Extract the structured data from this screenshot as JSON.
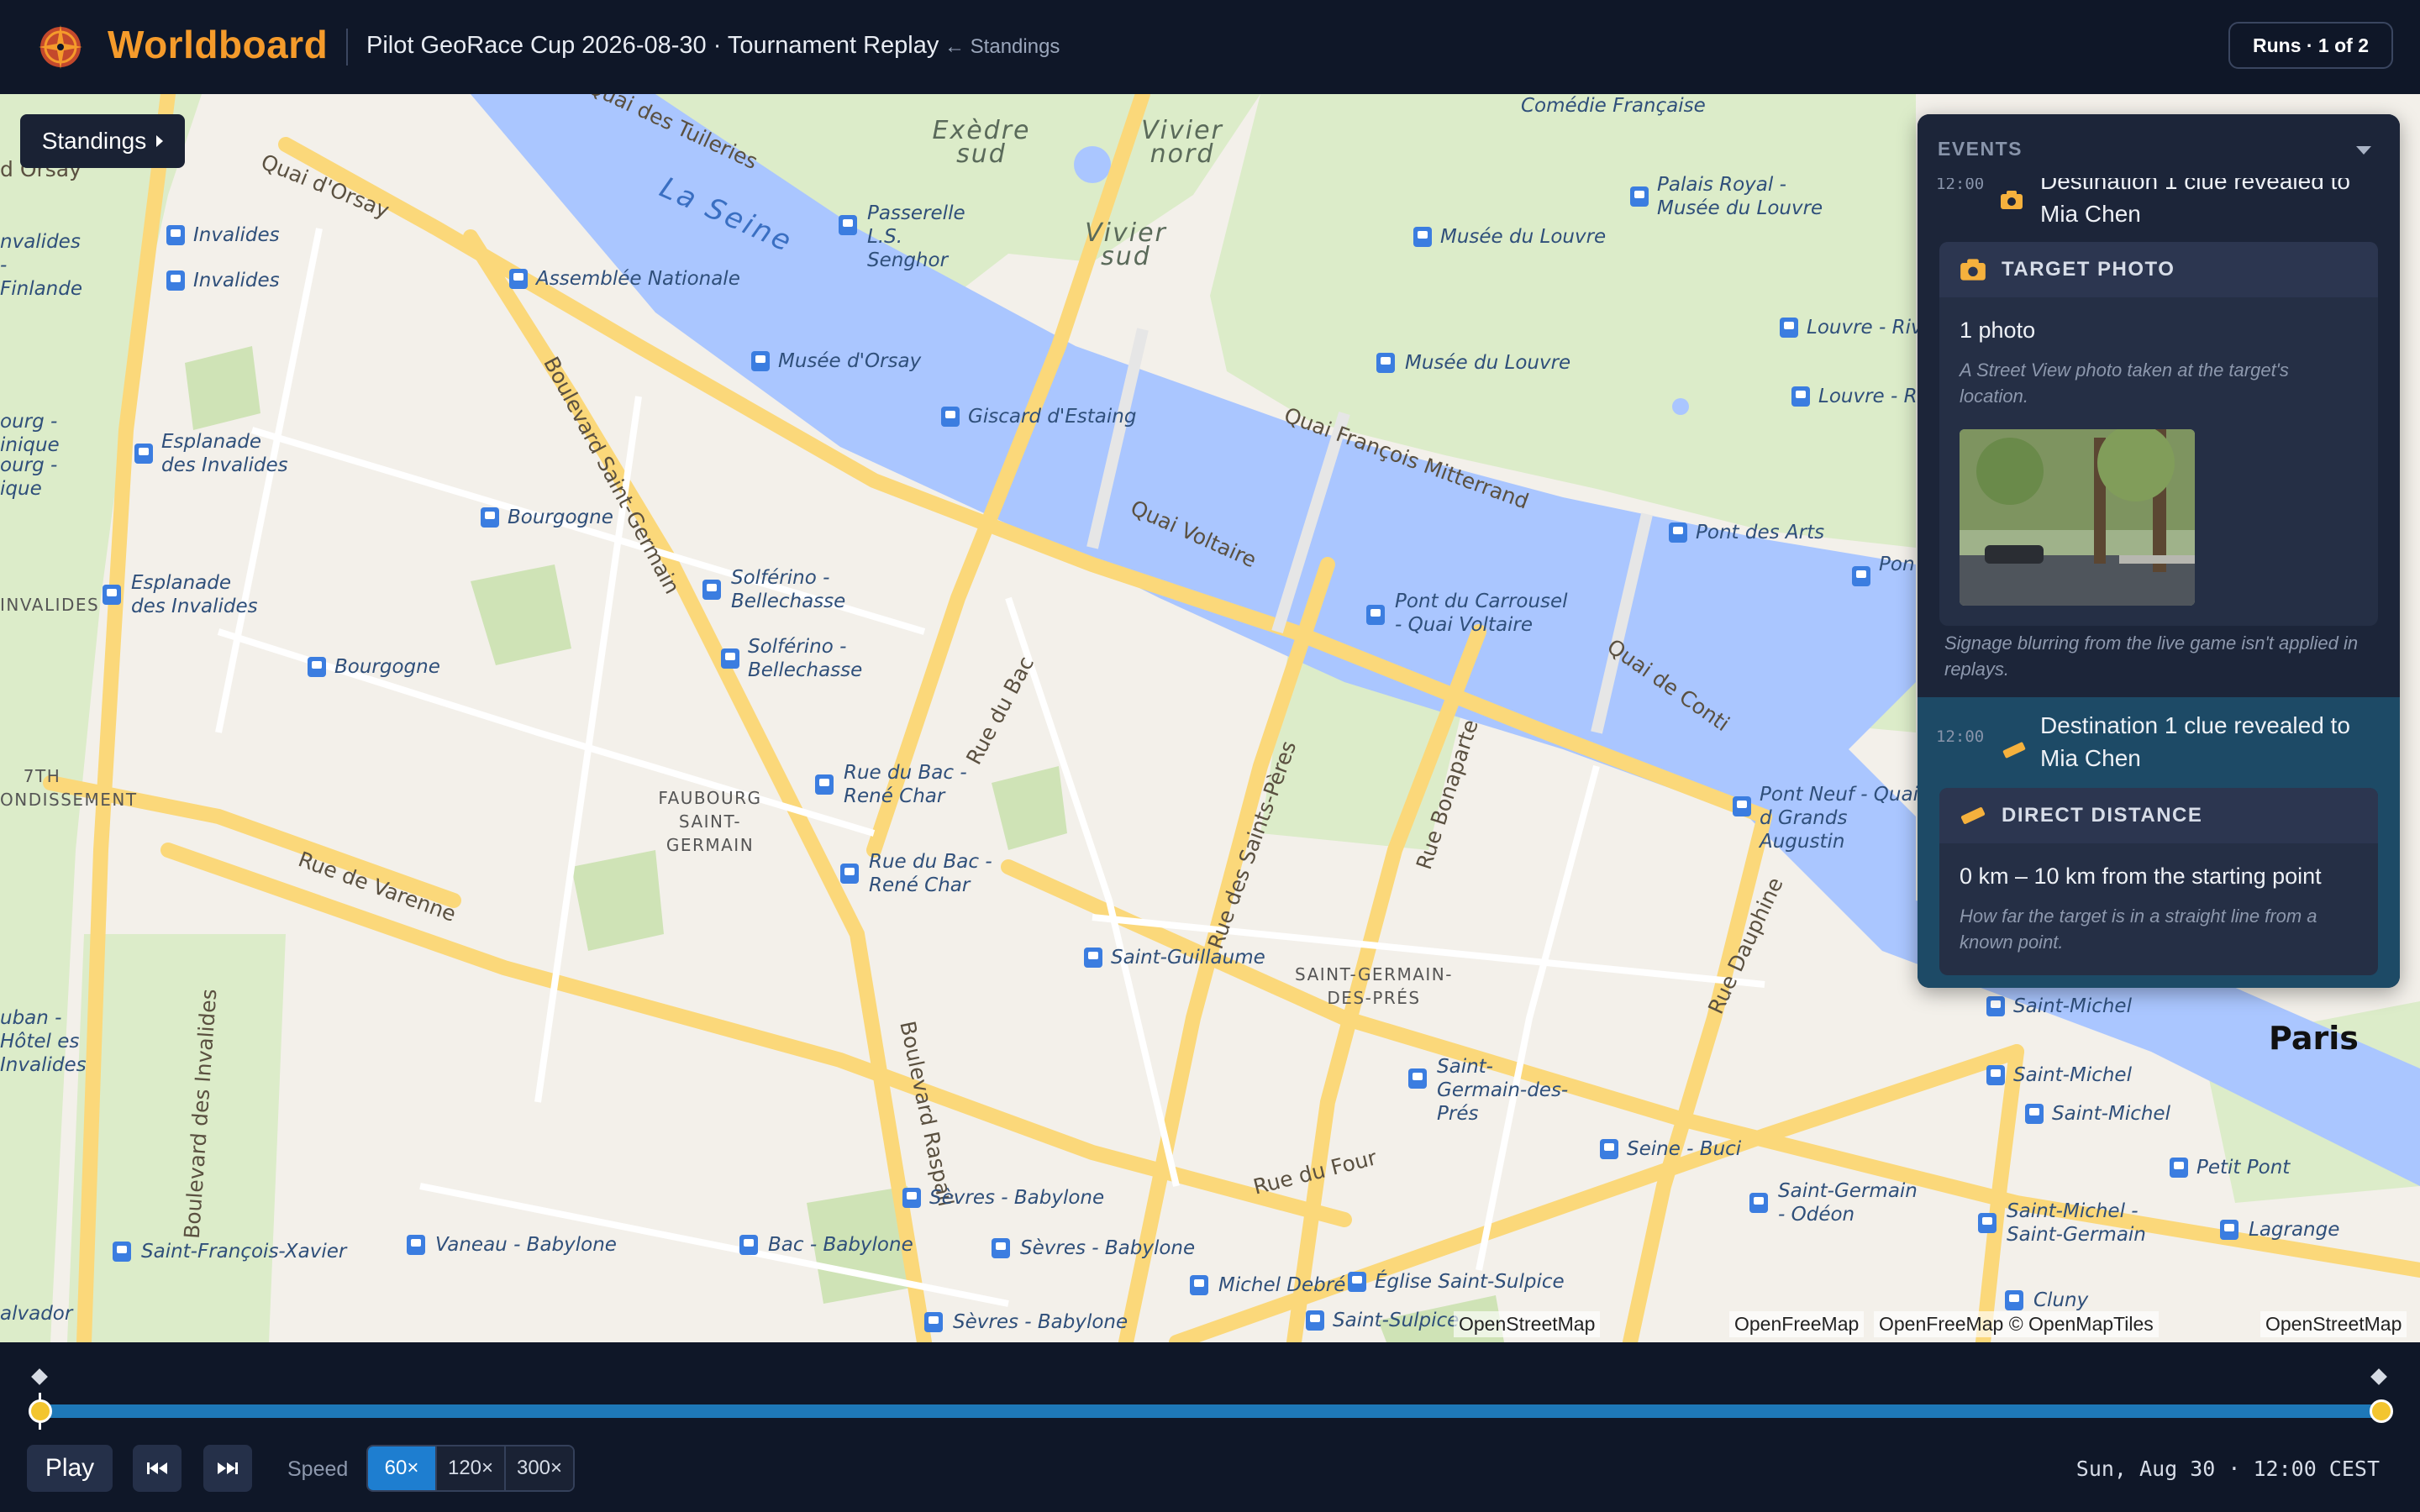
{
  "app": {
    "brand": "Worldboard",
    "title": "Pilot GeoRace Cup 2026-08-30 · Tournament Replay",
    "back_link": "← Standings",
    "runs_label": "Runs · 1 of 2",
    "brand_color": "#f59b2b"
  },
  "map": {
    "standings_button": "Standings",
    "streets": [
      "Quai des Tuileries",
      "Quai d'Orsay",
      "Boulevard Saint-Germain",
      "Quai François Mitterrand",
      "Quai Voltaire",
      "Rue du Bac",
      "Rue des Saints-Pères",
      "Rue Bonaparte",
      "Quai de Conti",
      "Rue Dauphine",
      "Rue de Varenne",
      "Boulevard Raspail",
      "Rue du Four",
      "Boulevard des Invalides"
    ],
    "water": "La Seine",
    "gardens": [
      "Exèdre sud",
      "Vivier nord",
      "Vivier sud"
    ],
    "districts": [
      "FAUBOURG SAINT-GERMAIN",
      "SAINT-GERMAIN-DES-PRÉS",
      "7TH ONDISSEMENT",
      "INVALIDES"
    ],
    "city": "Paris",
    "stations": [
      "Invalides",
      "Invalides",
      "Assemblée Nationale",
      "Passerelle L.S. Senghor",
      "Musée d'Orsay",
      "Giscard d'Estaing",
      "Esplanade des Invalides",
      "Esplanade des Invalides",
      "Bourgogne",
      "Bourgogne",
      "Solférino - Bellechasse",
      "Solférino - Bellechasse",
      "Rue du Bac - René Char",
      "Rue du Bac - René Char",
      "Saint-Guillaume",
      "Pont du Carrousel - Quai Voltaire",
      "Musée du Louvre",
      "Musée du Louvre",
      "Palais Royal - Musée du Louvre",
      "Louvre - Riv",
      "Louvre - Riv",
      "Pont des Arts",
      "Pon",
      "Pont Neuf - Quai d Grands Augustin",
      "Saint-Germain-des-Prés",
      "Seine - Buci",
      "Saint-Germain - Odéon",
      "Saint-Michel",
      "Saint-Michel",
      "Saint-Michel",
      "Petit Pont",
      "Saint-Michel - Saint-Germain",
      "Lagrange",
      "Cluny",
      "Sèvres - Babylone",
      "Sèvres - Babylone",
      "Sèvres - Babylone",
      "Bac - Babylone",
      "Vaneau - Babylone",
      "Saint-François-Xavier",
      "Michel Debré",
      "Église Saint-Sulpice",
      "Saint-Sulpice",
      "Comédie Française",
      "uban - Hôtel es Invalides",
      "nvalides - Finlande",
      "ourg - inique",
      "ourg - ique",
      "alvador",
      "d Orsay"
    ],
    "attributions": [
      "OpenStreetMap",
      "OpenFreeMap",
      "OpenFreeMap © OpenMapTiles",
      "OpenStreetMap"
    ],
    "colors": {
      "water": "#aac6ff",
      "park": "#dcecc9",
      "road": "#fbd87a",
      "land": "#f3f0ea"
    }
  },
  "events": {
    "title": "EVENTS",
    "items": [
      {
        "time": "12:00",
        "text": "Destination 1 clue revealed to Mia Chen",
        "icon": "camera-icon",
        "card": {
          "title": "TARGET PHOTO",
          "main": "1 photo",
          "desc": "A Street View photo taken at the target's location."
        },
        "note": "Signage blurring from the live game isn't applied in replays."
      },
      {
        "time": "12:00",
        "text": "Destination 1 clue revealed to Mia Chen",
        "icon": "ruler-icon",
        "card": {
          "title": "DIRECT DISTANCE",
          "main": "0 km – 10 km from the starting point",
          "desc": "How far the target is in a straight line from a known point."
        }
      }
    ]
  },
  "timeline": {
    "play_label": "Play",
    "speed_label": "Speed",
    "speeds": [
      "60×",
      "120×",
      "300×"
    ],
    "active_speed": "60×",
    "clock": "Sun, Aug 30 · 12:00 CEST",
    "progress": 0.0
  }
}
